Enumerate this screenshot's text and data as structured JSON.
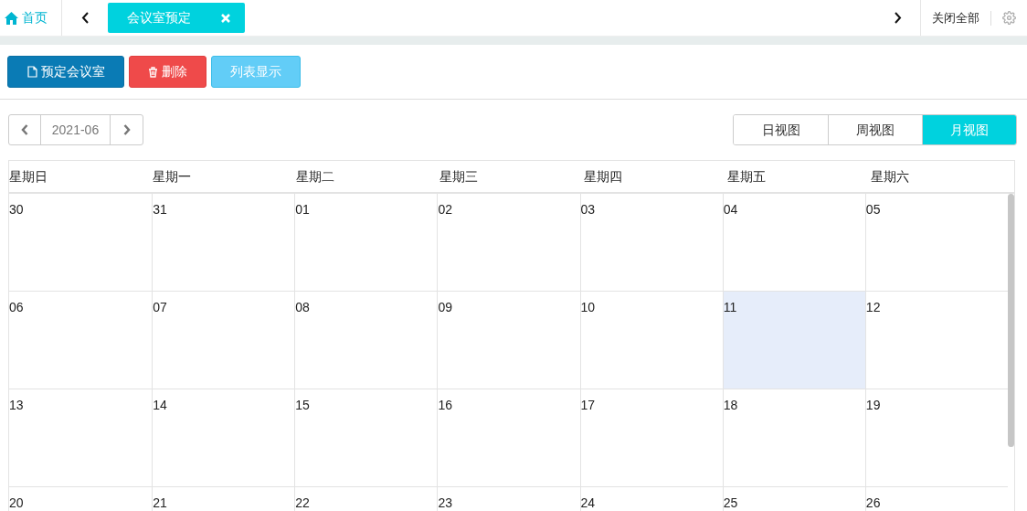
{
  "topbar": {
    "home": "首页",
    "tabs": [
      {
        "label": "会议室预定",
        "selected": true
      }
    ],
    "close_all": "关闭全部"
  },
  "toolbar": {
    "buttons": [
      {
        "kind": "primary",
        "label": "预定会议室"
      },
      {
        "kind": "danger",
        "label": "删除"
      },
      {
        "kind": "info",
        "label": "列表显示"
      }
    ]
  },
  "calendar": {
    "month": "2021-06",
    "views": [
      {
        "label": "日视图",
        "selected": false
      },
      {
        "label": "周视图",
        "selected": false
      },
      {
        "label": "月视图",
        "selected": true
      }
    ],
    "weekdays": [
      "星期日",
      "星期一",
      "星期二",
      "星期三",
      "星期四",
      "星期五",
      "星期六"
    ],
    "weeks": [
      [
        {
          "day": "30",
          "today": false
        },
        {
          "day": "31",
          "today": false
        },
        {
          "day": "01",
          "today": false
        },
        {
          "day": "02",
          "today": false
        },
        {
          "day": "03",
          "today": false
        },
        {
          "day": "04",
          "today": false
        },
        {
          "day": "05",
          "today": false
        }
      ],
      [
        {
          "day": "06",
          "today": false
        },
        {
          "day": "07",
          "today": false
        },
        {
          "day": "08",
          "today": false
        },
        {
          "day": "09",
          "today": false
        },
        {
          "day": "10",
          "today": false
        },
        {
          "day": "11",
          "today": true
        },
        {
          "day": "12",
          "today": false
        }
      ],
      [
        {
          "day": "13",
          "today": false
        },
        {
          "day": "14",
          "today": false
        },
        {
          "day": "15",
          "today": false
        },
        {
          "day": "16",
          "today": false
        },
        {
          "day": "17",
          "today": false
        },
        {
          "day": "18",
          "today": false
        },
        {
          "day": "19",
          "today": false
        }
      ],
      [
        {
          "day": "20",
          "today": false
        },
        {
          "day": "21",
          "today": false
        },
        {
          "day": "22",
          "today": false
        },
        {
          "day": "23",
          "today": false
        },
        {
          "day": "24",
          "today": false
        },
        {
          "day": "25",
          "today": false
        },
        {
          "day": "26",
          "today": false
        }
      ]
    ]
  }
}
